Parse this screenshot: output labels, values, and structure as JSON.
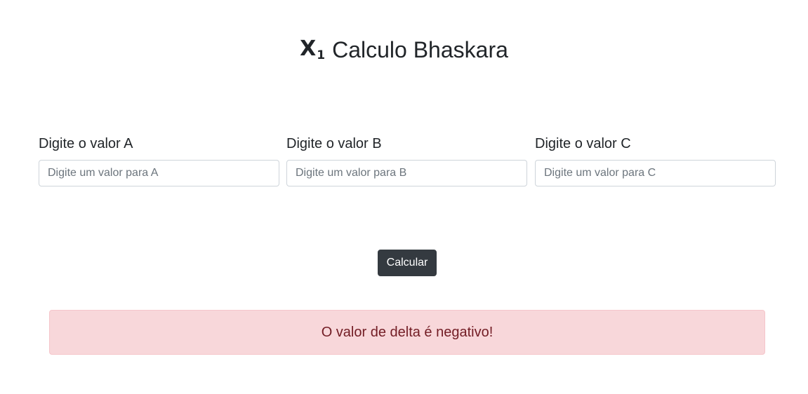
{
  "header": {
    "icon": "subscript-x1-icon",
    "icon_letter": "X",
    "icon_sub": "1",
    "title": "Calculo Bhaskara"
  },
  "form": {
    "fields": [
      {
        "label": "Digite o valor A",
        "placeholder": "Digite um valor para A",
        "value": ""
      },
      {
        "label": "Digite o valor B",
        "placeholder": "Digite um valor para B",
        "value": ""
      },
      {
        "label": "Digite o valor C",
        "placeholder": "Digite um valor para C",
        "value": ""
      }
    ],
    "submit_label": "Calcular"
  },
  "result": {
    "message": "O valor de delta é negativo!",
    "type": "danger"
  },
  "colors": {
    "button_bg": "#343a40",
    "alert_bg": "#f8d7da",
    "alert_border": "#f5c6cb",
    "alert_text": "#721c24"
  }
}
